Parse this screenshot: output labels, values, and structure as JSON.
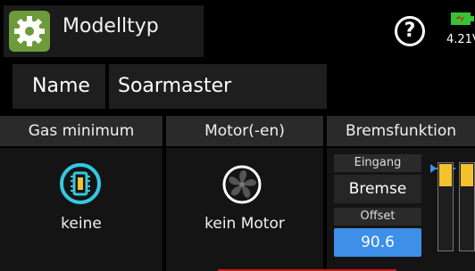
{
  "header": {
    "title": "Modelltyp",
    "app_icon": "gear-icon",
    "help_icon": "help-icon",
    "help_glyph": "?",
    "battery": {
      "voltage": "4.21V",
      "color": "#36c436"
    }
  },
  "name_row": {
    "label": "Name",
    "value": "Soarmaster"
  },
  "columns": [
    {
      "header": "Gas minimum",
      "icon": "throttle-chip-icon",
      "value": "keine"
    },
    {
      "header": "Motor(-en)",
      "icon": "fan-motor-icon",
      "value": "kein Motor"
    },
    {
      "header": "Bremsfunktion"
    }
  ],
  "brake": {
    "input_label": "Eingang",
    "input_value": "Bremse",
    "offset_label": "Offset",
    "offset_value": "90.6",
    "bar_fill": 0.25,
    "accent": "#3d8fe8",
    "bar_color": "#f4c22b"
  }
}
